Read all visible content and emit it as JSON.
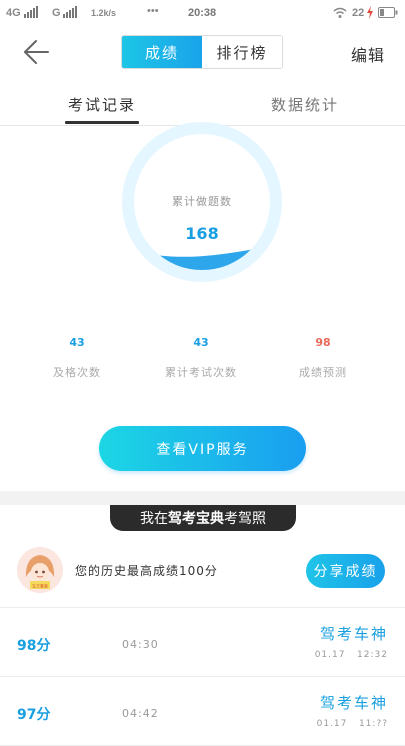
{
  "status_bar": {
    "network1": "4G",
    "network2": "G",
    "speed": "1.2k/s",
    "dots": "•••",
    "time": "20:38",
    "battery": "22"
  },
  "header": {
    "tabs": [
      {
        "label": "成绩",
        "active": true
      },
      {
        "label": "排行榜",
        "active": false
      }
    ],
    "edit_label": "编辑"
  },
  "sub_tabs": [
    {
      "label": "考试记录",
      "active": true
    },
    {
      "label": "数据统计",
      "active": false
    }
  ],
  "gauge": {
    "label": "累计做题数",
    "value": "168"
  },
  "stats": [
    {
      "value": "43",
      "label": "及格次数",
      "color": "#1a9fe3"
    },
    {
      "value": "43",
      "label": "累计考试次数",
      "color": "#1a9fe3"
    },
    {
      "value": "98",
      "label": "成绩预测",
      "color": "#e86a5a"
    }
  ],
  "vip_button": "查看VIP服务",
  "watermark": {
    "pre": "我在",
    "brand": "驾考宝典",
    "post": "考驾照"
  },
  "best": {
    "text": "您的历史最高成绩100分",
    "share_label": "分享成绩",
    "avatar_badge": "车王套装"
  },
  "records": [
    {
      "score": "98分",
      "duration": "04:30",
      "title": "驾考车神",
      "date": "01.17   12:32"
    },
    {
      "score": "97分",
      "duration": "04:42",
      "title": "驾考车神",
      "date": "01.17   11:??"
    }
  ],
  "colors": {
    "accent": "#1aa0e8",
    "accent_light": "#1dd0e4",
    "gauge_ring": "#e4f6ff",
    "warning": "#e86a5a"
  }
}
